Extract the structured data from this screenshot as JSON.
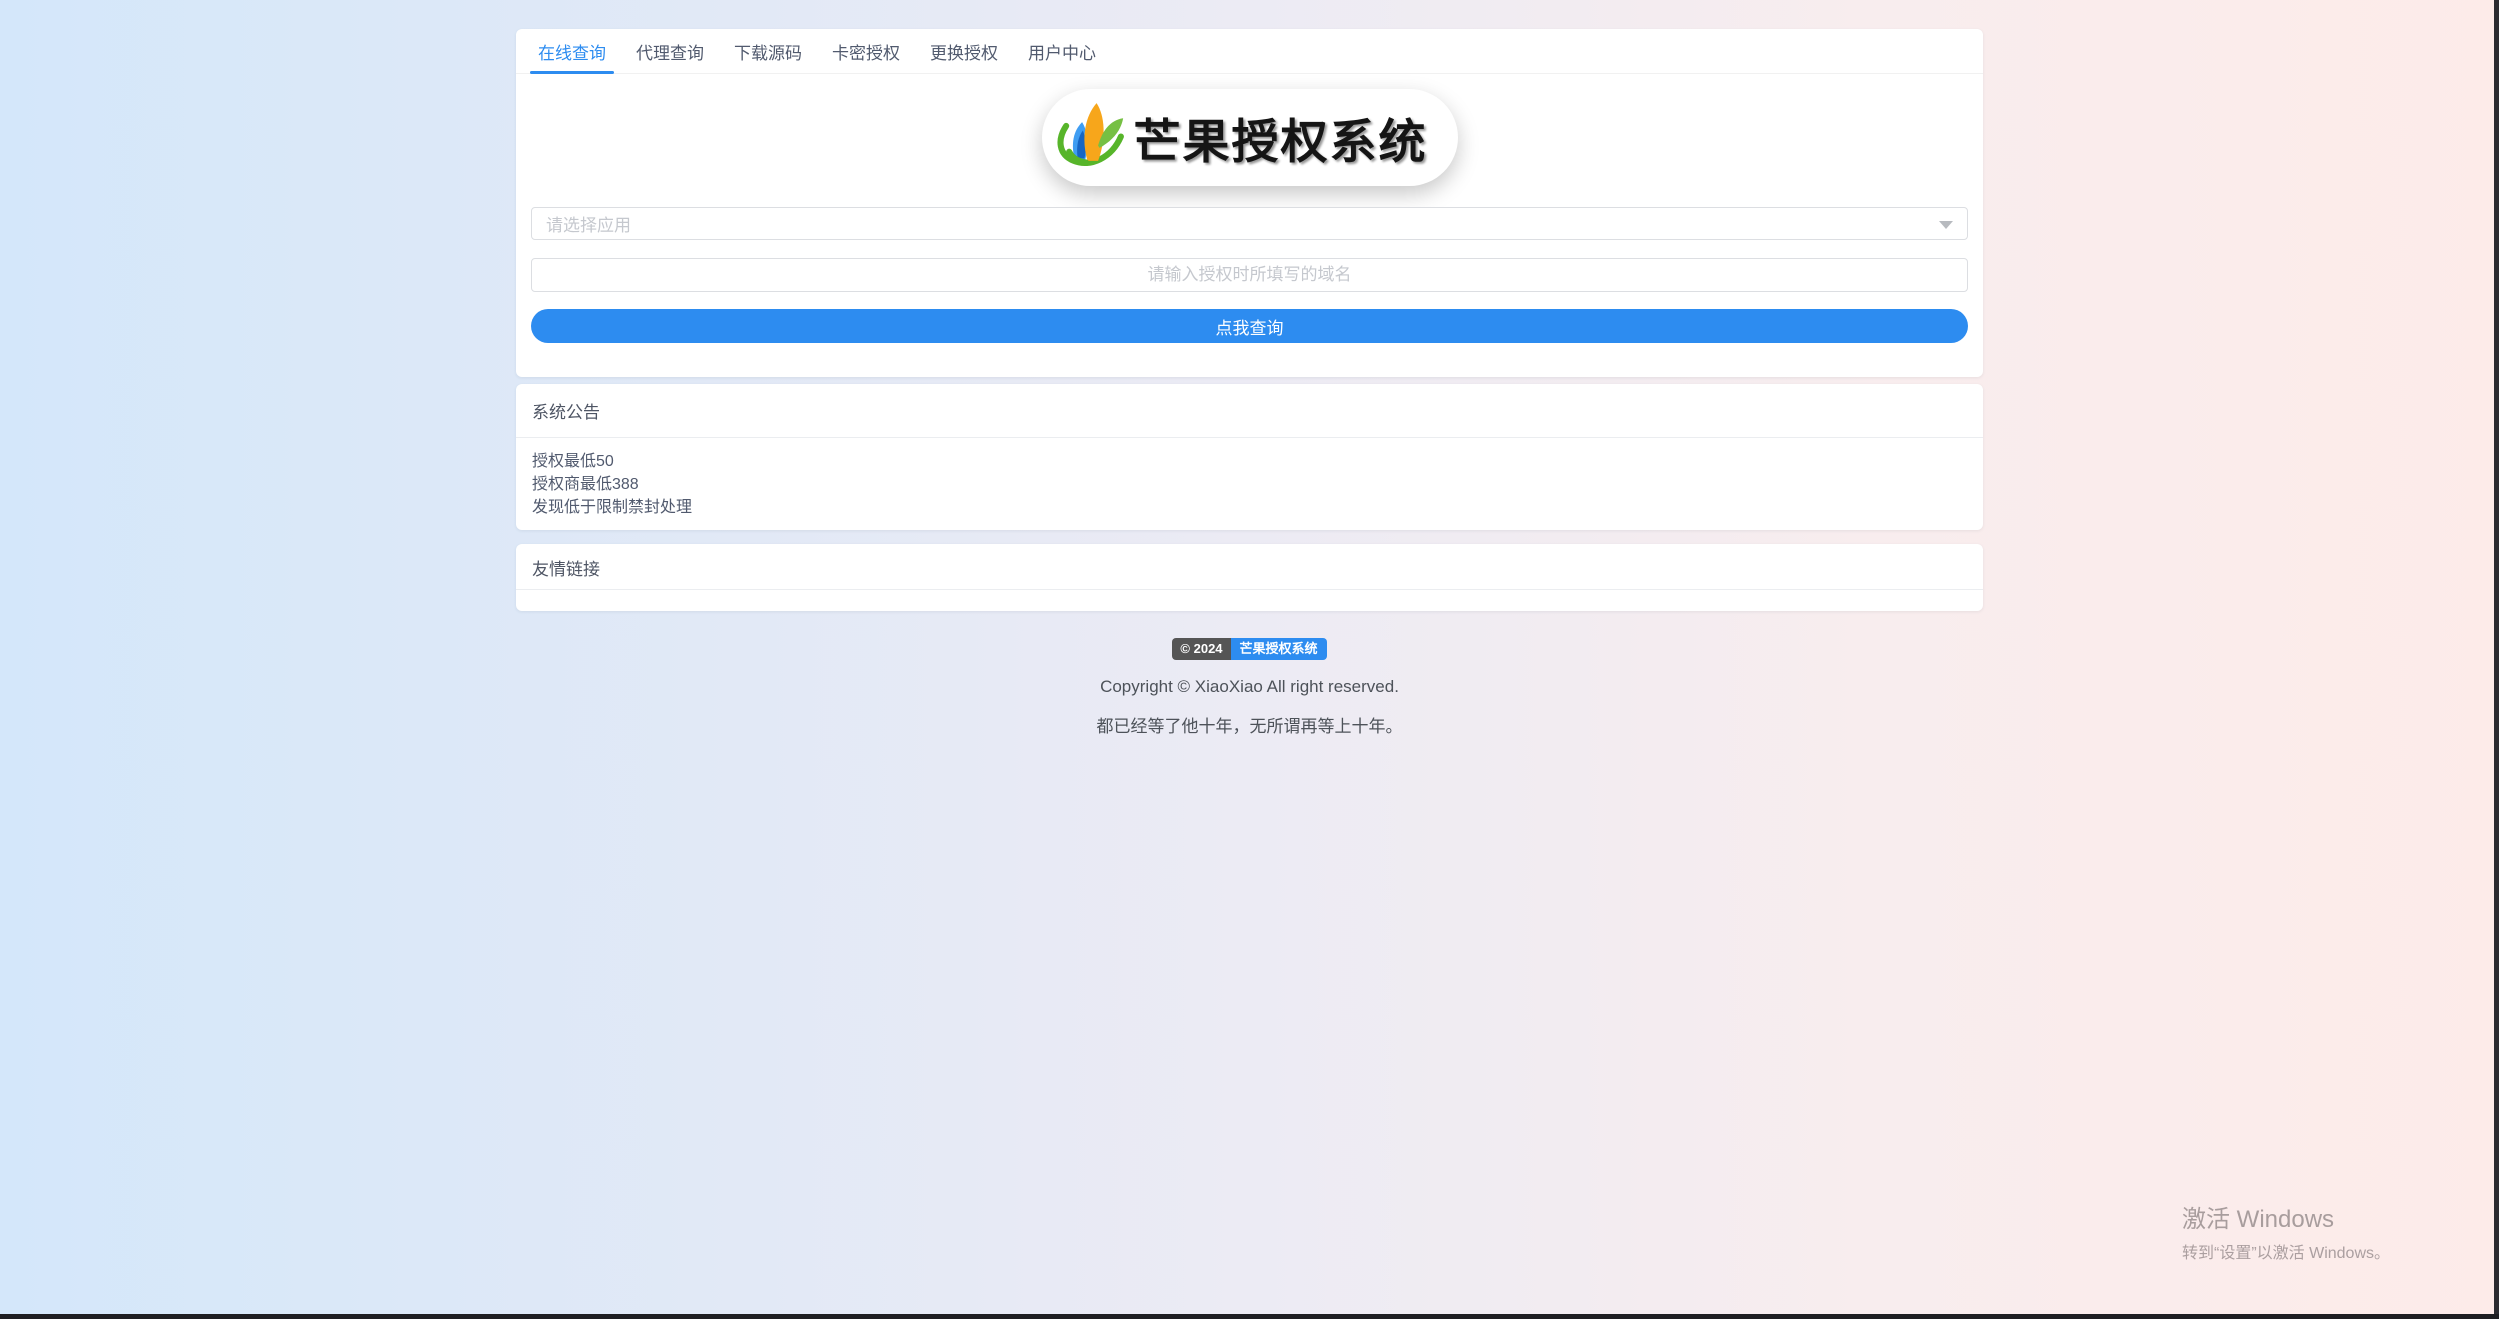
{
  "nav": {
    "tabs": [
      {
        "label": "在线查询",
        "active": true
      },
      {
        "label": "代理查询",
        "active": false
      },
      {
        "label": "下载源码",
        "active": false
      },
      {
        "label": "卡密授权",
        "active": false
      },
      {
        "label": "更换授权",
        "active": false
      },
      {
        "label": "用户中心",
        "active": false
      }
    ]
  },
  "logo": {
    "title": "芒果授权系统"
  },
  "query_form": {
    "app_select_placeholder": "请选择应用",
    "domain_input_placeholder": "请输入授权时所填写的域名",
    "submit_label": "点我查询"
  },
  "announcement": {
    "title": "系统公告",
    "lines": [
      "授权最低50",
      "授权商最低388",
      "发现低于限制禁封处理"
    ]
  },
  "friend_links": {
    "title": "友情链接"
  },
  "footer": {
    "badge": {
      "left": "© 2024",
      "right": "芒果授权系统"
    },
    "copyright": "Copyright © XiaoXiao All right reserved.",
    "quote": "都已经等了他十年，无所谓再等上十年。"
  },
  "os_watermark": {
    "title": "激活 Windows",
    "subtitle": "转到“设置”以激活 Windows。"
  },
  "colors": {
    "primary": "#2d8cf0",
    "badge_left_bg": "#555555",
    "badge_right_bg": "#2d8cf0",
    "background_left": "#d4e7fa",
    "background_right": "#fdebe9"
  }
}
